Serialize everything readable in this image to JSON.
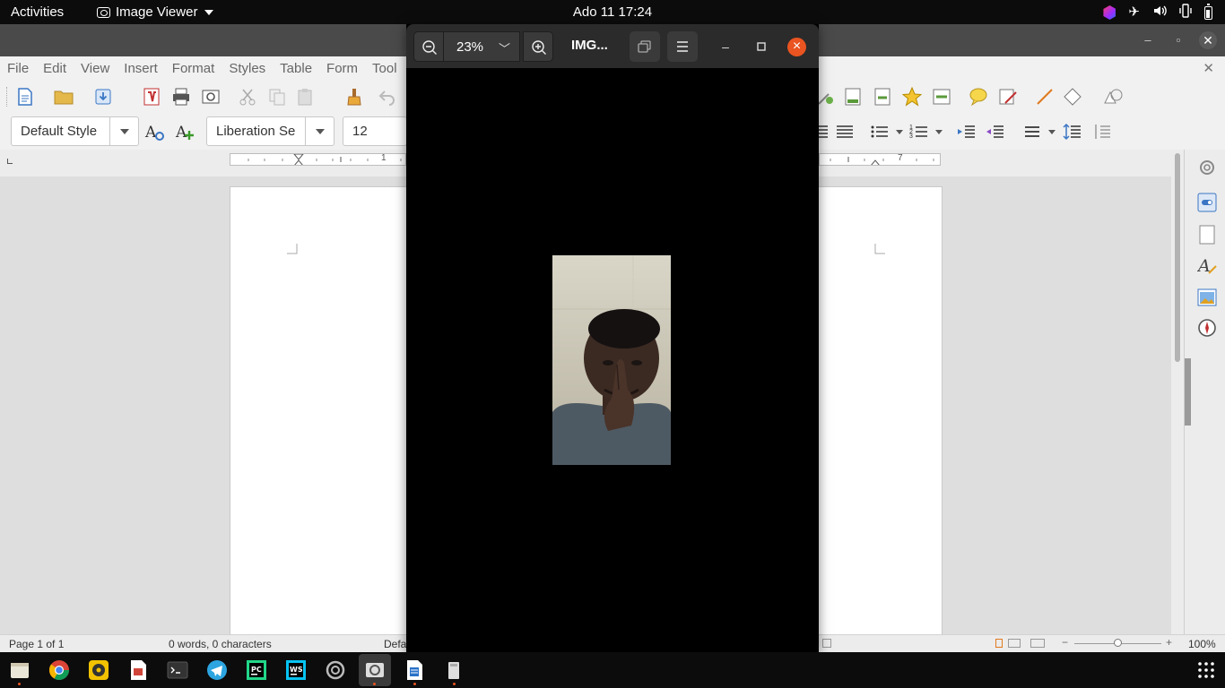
{
  "topbar": {
    "activities": "Activities",
    "app_name": "Image Viewer",
    "clock": "Ado 11  17:24"
  },
  "writer": {
    "menu": [
      "File",
      "Edit",
      "View",
      "Insert",
      "Format",
      "Styles",
      "Table",
      "Form",
      "Tool"
    ],
    "paragraph_style": "Default Style",
    "font_name": "Liberation Se",
    "font_size": "12",
    "ruler_labels": {
      "left_1": "1",
      "right_7": "7"
    },
    "status": {
      "page": "Page 1 of 1",
      "words": "0 words, 0 characters",
      "style_partial": "Defa",
      "zoom": "100%"
    },
    "colors": {
      "toolbar_bg": "#f1f1f1",
      "titlebar_bg": "#4a4a4a",
      "page_bg": "#ffffff"
    }
  },
  "viewer": {
    "zoom": "23%",
    "title": "IMG...",
    "colors": {
      "header_bg": "#2b2b2b",
      "close": "#e95420",
      "canvas_bg": "#000000"
    }
  },
  "taskbar": {
    "apps": [
      "files",
      "chrome",
      "rhythmbox",
      "libreoffice-impress",
      "terminal",
      "telegram",
      "pycharm",
      "webstorm",
      "settings",
      "image-viewer",
      "libreoffice-writer",
      "trash"
    ],
    "accent": "#e95420"
  }
}
